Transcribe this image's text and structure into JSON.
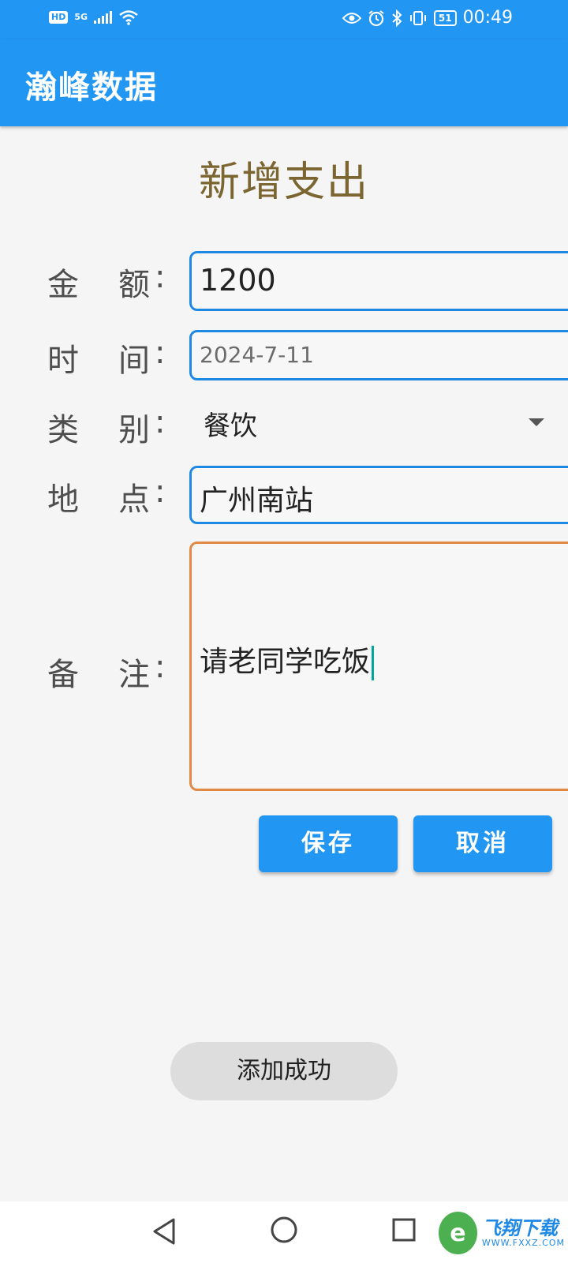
{
  "status_bar": {
    "hd": "HD",
    "network": "5G",
    "battery": "51",
    "time": "00:49"
  },
  "app_bar": {
    "title": "瀚峰数据"
  },
  "page": {
    "title": "新增支出"
  },
  "form": {
    "amount": {
      "label_1": "金",
      "label_2": "额",
      "colon": ":",
      "value": "1200"
    },
    "time": {
      "label_1": "时",
      "label_2": "间",
      "colon": ":",
      "value": "2024-7-11"
    },
    "category": {
      "label_1": "类",
      "label_2": "别",
      "colon": ":",
      "selected": "餐饮"
    },
    "location": {
      "label_1": "地",
      "label_2": "点",
      "colon": ":",
      "value": "广州南站"
    },
    "notes": {
      "label_1": "备",
      "label_2": "注",
      "colon": ":",
      "value": "请老同学吃饭"
    }
  },
  "buttons": {
    "save": "保存",
    "cancel": "取消"
  },
  "toast": {
    "message": "添加成功"
  },
  "watermark": {
    "main": "飞翔下载",
    "sub": "WWW.FXXZ.COM",
    "logo": "e"
  },
  "colors": {
    "primary": "#2196f3",
    "title": "#7b6530",
    "focused_border": "#e08a45",
    "field_border": "#1e88e5",
    "cursor": "#00a79d"
  }
}
